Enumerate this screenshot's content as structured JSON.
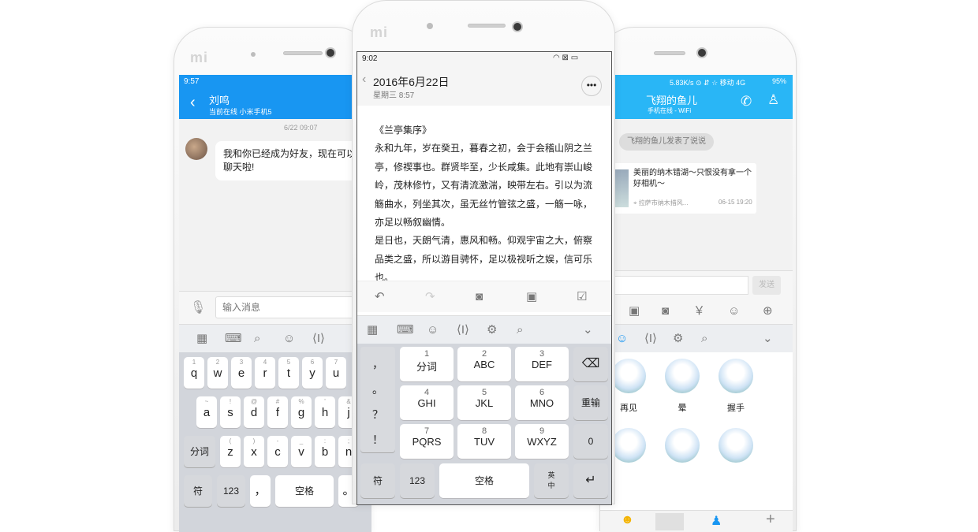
{
  "left": {
    "time": "9:57",
    "contact_name": "刘鸣",
    "contact_status": "当前在线 小米手机5",
    "msg_time": "6/22 09:07",
    "message": "我和你已经成为好友，现在可以开始聊天啦!",
    "input_placeholder": "输入消息",
    "rows": [
      [
        "q",
        "w",
        "e",
        "r",
        "t",
        "y",
        "u"
      ],
      [
        "a",
        "s",
        "d",
        "f",
        "g",
        "h",
        "j"
      ],
      [
        "z",
        "x",
        "c",
        "v",
        "b",
        "n"
      ]
    ],
    "row_sub": [
      [
        "1",
        "2",
        "3",
        "4",
        "5",
        "6",
        "7"
      ],
      [
        "~",
        "!",
        "@",
        "#",
        "%",
        "'",
        "&"
      ],
      [
        "(",
        ")",
        "-",
        "_",
        ":",
        ";"
      ]
    ],
    "fenci": "分词",
    "fu": "符",
    "num": "123",
    "comma": "，",
    "space": "空格",
    "dot": "。"
  },
  "middle": {
    "time": "9:02",
    "title": "2016年6月22日",
    "subtitle": "星期三 8:57",
    "body": [
      "《兰亭集序》",
      "永和九年，岁在癸丑，暮春之初，会于会稽山阴之兰",
      "亭，修禊事也。群贤毕至，少长咸集。此地有崇山峻",
      "岭，茂林修竹，又有清流激湍，映带左右。引以为流",
      "觞曲水，列坐其次，虽无丝竹管弦之盛，一觞一咏，",
      "亦足以畅叙幽情。",
      "是日也，天朗气清，惠风和畅。仰观宇宙之大，俯察",
      "品类之盛，所以游目骋怀，足以极视听之娱，信可乐",
      "也。"
    ],
    "punct": [
      "，",
      "。",
      "？",
      "！"
    ],
    "t9": [
      {
        "n": "1",
        "l": "分词"
      },
      {
        "n": "2",
        "l": "ABC"
      },
      {
        "n": "3",
        "l": "DEF"
      },
      {
        "n": "4",
        "l": "GHI"
      },
      {
        "n": "5",
        "l": "JKL"
      },
      {
        "n": "6",
        "l": "MNO"
      },
      {
        "n": "7",
        "l": "PQRS"
      },
      {
        "n": "8",
        "l": "TUV"
      },
      {
        "n": "9",
        "l": "WXYZ"
      }
    ],
    "rewrite": "重输",
    "zero": "0",
    "fu": "符",
    "num": "123",
    "space": "空格",
    "lang_en": "英",
    "lang_zh": "中"
  },
  "right": {
    "status": "5.83K/s  ⊙ ⇵ ☆ 移动 4G",
    "battery": "95%",
    "name": "飞翔的鱼儿",
    "sub": "手机在线 - WiFi",
    "notice": "飞翔的鱼儿发表了说说",
    "card_title": "美丽的纳木错湖～只恨没有拿一个好相机～",
    "card_loc": "拉萨市纳木措风...",
    "card_time": "06-15 19:20",
    "send": "发送",
    "stickers": [
      "再见",
      "晕",
      "握手"
    ]
  }
}
